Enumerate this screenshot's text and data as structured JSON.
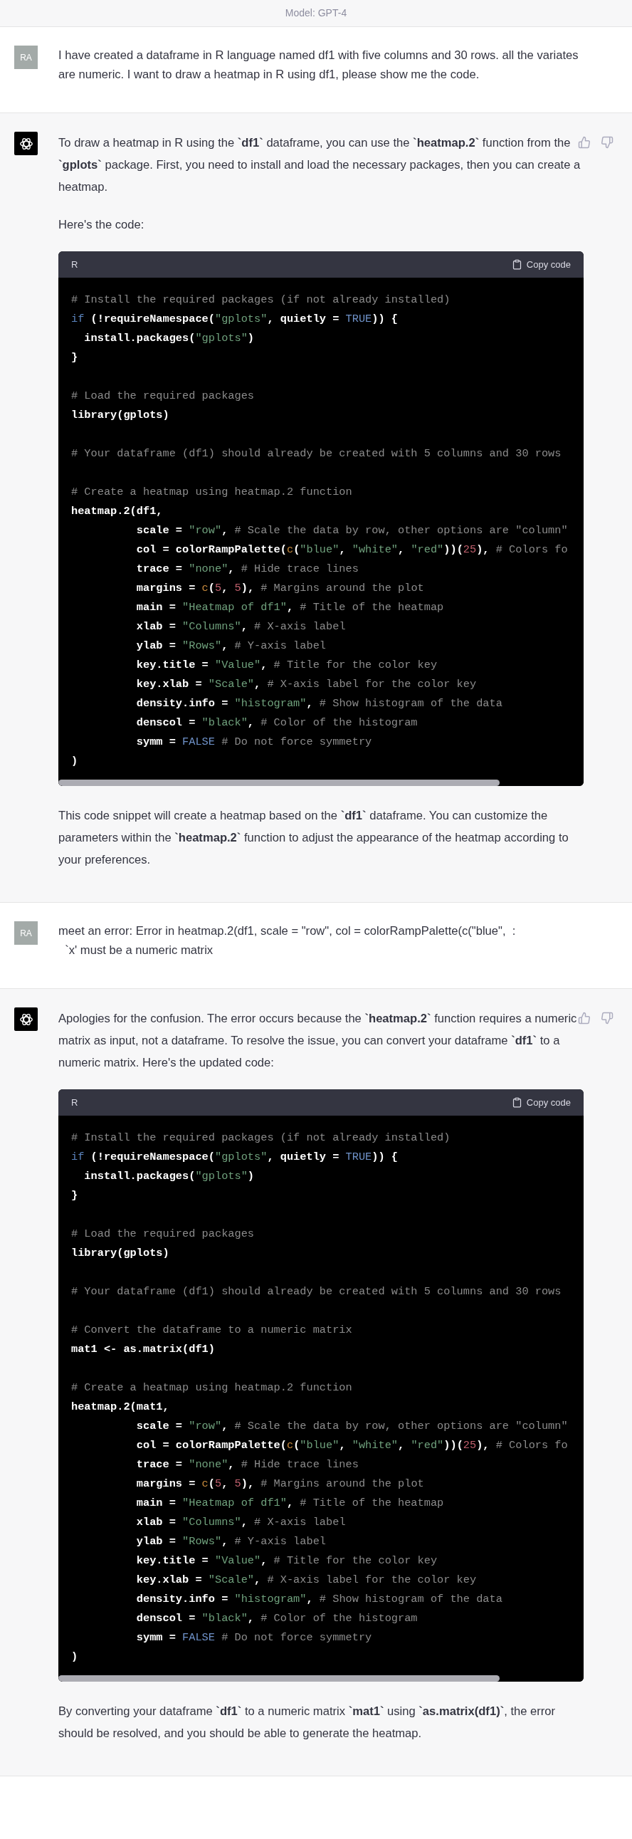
{
  "header": {
    "model_label": "Model: GPT-4"
  },
  "messages": [
    {
      "kind": "user",
      "avatar": "RA",
      "blocks": [
        {
          "kind": "paragraph",
          "text": "I have created a dataframe in R language named df1 with five columns and 30 rows. all the variates are numeric. I want to draw a heatmap in R using df1, please show me the code."
        }
      ]
    },
    {
      "kind": "assistant",
      "blocks": [
        {
          "kind": "paragraph",
          "text": "To draw a heatmap in R using the **`df1`** dataframe, you can use the **`heatmap.2`** function from the **`gplots`** package. First, you need to install and load the necessary packages, then you can create a heatmap."
        },
        {
          "kind": "paragraph",
          "text": "Here's the code:"
        },
        {
          "kind": "code",
          "language": "R",
          "copy_label": "Copy code",
          "lines": [
            {
              "kind": "code",
              "tokens": [
                {
                  "kind": "comment",
                  "text": "# Install the required packages (if not already installed)"
                }
              ]
            },
            {
              "kind": "code",
              "tokens": [
                {
                  "kind": "keyword",
                  "text": "if"
                },
                {
                  "kind": "plain",
                  "text": " (!requireNamespace("
                },
                {
                  "kind": "string",
                  "text": "\"gplots\""
                },
                {
                  "kind": "plain",
                  "text": ", quietly = "
                },
                {
                  "kind": "literal",
                  "text": "TRUE"
                },
                {
                  "kind": "plain",
                  "text": ")) {"
                }
              ]
            },
            {
              "kind": "code",
              "tokens": [
                {
                  "kind": "plain",
                  "text": "  install.packages("
                },
                {
                  "kind": "string",
                  "text": "\"gplots\""
                },
                {
                  "kind": "plain",
                  "text": ")"
                }
              ]
            },
            {
              "kind": "code",
              "tokens": [
                {
                  "kind": "plain",
                  "text": "}"
                }
              ]
            },
            {
              "kind": "blank"
            },
            {
              "kind": "code",
              "tokens": [
                {
                  "kind": "comment",
                  "text": "# Load the required packages"
                }
              ]
            },
            {
              "kind": "code",
              "tokens": [
                {
                  "kind": "plain",
                  "text": "library(gplots)"
                }
              ]
            },
            {
              "kind": "blank"
            },
            {
              "kind": "code",
              "tokens": [
                {
                  "kind": "comment",
                  "text": "# Your dataframe (df1) should already be created with 5 columns and 30 rows"
                }
              ]
            },
            {
              "kind": "blank"
            },
            {
              "kind": "code",
              "tokens": [
                {
                  "kind": "comment",
                  "text": "# Create a heatmap using heatmap.2 function"
                }
              ]
            },
            {
              "kind": "code",
              "tokens": [
                {
                  "kind": "plain",
                  "text": "heatmap.2(df1,"
                }
              ]
            },
            {
              "kind": "code",
              "tokens": [
                {
                  "kind": "plain",
                  "text": "          scale = "
                },
                {
                  "kind": "string",
                  "text": "\"row\""
                },
                {
                  "kind": "plain",
                  "text": ", "
                },
                {
                  "kind": "comment",
                  "text": "# Scale the data by row, other options are \"column\""
                }
              ]
            },
            {
              "kind": "code",
              "tokens": [
                {
                  "kind": "plain",
                  "text": "          col = colorRampPalette("
                },
                {
                  "kind": "builtin",
                  "text": "c"
                },
                {
                  "kind": "plain",
                  "text": "("
                },
                {
                  "kind": "string",
                  "text": "\"blue\""
                },
                {
                  "kind": "plain",
                  "text": ", "
                },
                {
                  "kind": "string",
                  "text": "\"white\""
                },
                {
                  "kind": "plain",
                  "text": ", "
                },
                {
                  "kind": "string",
                  "text": "\"red\""
                },
                {
                  "kind": "plain",
                  "text": "))("
                },
                {
                  "kind": "number",
                  "text": "25"
                },
                {
                  "kind": "plain",
                  "text": "), "
                },
                {
                  "kind": "comment",
                  "text": "# Colors fo"
                }
              ]
            },
            {
              "kind": "code",
              "tokens": [
                {
                  "kind": "plain",
                  "text": "          trace = "
                },
                {
                  "kind": "string",
                  "text": "\"none\""
                },
                {
                  "kind": "plain",
                  "text": ", "
                },
                {
                  "kind": "comment",
                  "text": "# Hide trace lines"
                }
              ]
            },
            {
              "kind": "code",
              "tokens": [
                {
                  "kind": "plain",
                  "text": "          margins = "
                },
                {
                  "kind": "builtin",
                  "text": "c"
                },
                {
                  "kind": "plain",
                  "text": "("
                },
                {
                  "kind": "number",
                  "text": "5"
                },
                {
                  "kind": "plain",
                  "text": ", "
                },
                {
                  "kind": "number",
                  "text": "5"
                },
                {
                  "kind": "plain",
                  "text": "), "
                },
                {
                  "kind": "comment",
                  "text": "# Margins around the plot"
                }
              ]
            },
            {
              "kind": "code",
              "tokens": [
                {
                  "kind": "plain",
                  "text": "          main = "
                },
                {
                  "kind": "string",
                  "text": "\"Heatmap of df1\""
                },
                {
                  "kind": "plain",
                  "text": ", "
                },
                {
                  "kind": "comment",
                  "text": "# Title of the heatmap"
                }
              ]
            },
            {
              "kind": "code",
              "tokens": [
                {
                  "kind": "plain",
                  "text": "          xlab = "
                },
                {
                  "kind": "string",
                  "text": "\"Columns\""
                },
                {
                  "kind": "plain",
                  "text": ", "
                },
                {
                  "kind": "comment",
                  "text": "# X-axis label"
                }
              ]
            },
            {
              "kind": "code",
              "tokens": [
                {
                  "kind": "plain",
                  "text": "          ylab = "
                },
                {
                  "kind": "string",
                  "text": "\"Rows\""
                },
                {
                  "kind": "plain",
                  "text": ", "
                },
                {
                  "kind": "comment",
                  "text": "# Y-axis label"
                }
              ]
            },
            {
              "kind": "code",
              "tokens": [
                {
                  "kind": "plain",
                  "text": "          key.title = "
                },
                {
                  "kind": "string",
                  "text": "\"Value\""
                },
                {
                  "kind": "plain",
                  "text": ", "
                },
                {
                  "kind": "comment",
                  "text": "# Title for the color key"
                }
              ]
            },
            {
              "kind": "code",
              "tokens": [
                {
                  "kind": "plain",
                  "text": "          key.xlab = "
                },
                {
                  "kind": "string",
                  "text": "\"Scale\""
                },
                {
                  "kind": "plain",
                  "text": ", "
                },
                {
                  "kind": "comment",
                  "text": "# X-axis label for the color key"
                }
              ]
            },
            {
              "kind": "code",
              "tokens": [
                {
                  "kind": "plain",
                  "text": "          density.info = "
                },
                {
                  "kind": "string",
                  "text": "\"histogram\""
                },
                {
                  "kind": "plain",
                  "text": ", "
                },
                {
                  "kind": "comment",
                  "text": "# Show histogram of the data"
                }
              ]
            },
            {
              "kind": "code",
              "tokens": [
                {
                  "kind": "plain",
                  "text": "          denscol = "
                },
                {
                  "kind": "string",
                  "text": "\"black\""
                },
                {
                  "kind": "plain",
                  "text": ", "
                },
                {
                  "kind": "comment",
                  "text": "# Color of the histogram"
                }
              ]
            },
            {
              "kind": "code",
              "tokens": [
                {
                  "kind": "plain",
                  "text": "          symm = "
                },
                {
                  "kind": "literal",
                  "text": "FALSE "
                },
                {
                  "kind": "comment",
                  "text": "# Do not force symmetry"
                }
              ]
            },
            {
              "kind": "code",
              "tokens": [
                {
                  "kind": "plain",
                  "text": ")"
                }
              ]
            }
          ]
        },
        {
          "kind": "paragraph",
          "text": "This code snippet will create a heatmap based on the **`df1`** dataframe. You can customize the parameters within the **`heatmap.2`** function to adjust the appearance of the heatmap according to your preferences."
        }
      ]
    },
    {
      "kind": "user",
      "avatar": "RA",
      "blocks": [
        {
          "kind": "paragraph",
          "text": "meet an error: Error in heatmap.2(df1, scale = \"row\", col = colorRampPalette(c(\"blue\",  :\n  `x' must be a numeric matrix"
        }
      ]
    },
    {
      "kind": "assistant",
      "blocks": [
        {
          "kind": "paragraph",
          "text": "Apologies for the confusion. The error occurs because the **`heatmap.2`** function requires a numeric matrix as input, not a dataframe. To resolve the issue, you can convert your dataframe **`df1`** to a numeric matrix. Here's the updated code:"
        },
        {
          "kind": "code",
          "language": "R",
          "copy_label": "Copy code",
          "lines": [
            {
              "kind": "code",
              "tokens": [
                {
                  "kind": "comment",
                  "text": "# Install the required packages (if not already installed)"
                }
              ]
            },
            {
              "kind": "code",
              "tokens": [
                {
                  "kind": "keyword",
                  "text": "if"
                },
                {
                  "kind": "plain",
                  "text": " (!requireNamespace("
                },
                {
                  "kind": "string",
                  "text": "\"gplots\""
                },
                {
                  "kind": "plain",
                  "text": ", quietly = "
                },
                {
                  "kind": "literal",
                  "text": "TRUE"
                },
                {
                  "kind": "plain",
                  "text": ")) {"
                }
              ]
            },
            {
              "kind": "code",
              "tokens": [
                {
                  "kind": "plain",
                  "text": "  install.packages("
                },
                {
                  "kind": "string",
                  "text": "\"gplots\""
                },
                {
                  "kind": "plain",
                  "text": ")"
                }
              ]
            },
            {
              "kind": "code",
              "tokens": [
                {
                  "kind": "plain",
                  "text": "}"
                }
              ]
            },
            {
              "kind": "blank"
            },
            {
              "kind": "code",
              "tokens": [
                {
                  "kind": "comment",
                  "text": "# Load the required packages"
                }
              ]
            },
            {
              "kind": "code",
              "tokens": [
                {
                  "kind": "plain",
                  "text": "library(gplots)"
                }
              ]
            },
            {
              "kind": "blank"
            },
            {
              "kind": "code",
              "tokens": [
                {
                  "kind": "comment",
                  "text": "# Your dataframe (df1) should already be created with 5 columns and 30 rows"
                }
              ]
            },
            {
              "kind": "blank"
            },
            {
              "kind": "code",
              "tokens": [
                {
                  "kind": "comment",
                  "text": "# Convert the dataframe to a numeric matrix"
                }
              ]
            },
            {
              "kind": "code",
              "tokens": [
                {
                  "kind": "plain",
                  "text": "mat1 <- as.matrix(df1)"
                }
              ]
            },
            {
              "kind": "blank"
            },
            {
              "kind": "code",
              "tokens": [
                {
                  "kind": "comment",
                  "text": "# Create a heatmap using heatmap.2 function"
                }
              ]
            },
            {
              "kind": "code",
              "tokens": [
                {
                  "kind": "plain",
                  "text": "heatmap.2(mat1,"
                }
              ]
            },
            {
              "kind": "code",
              "tokens": [
                {
                  "kind": "plain",
                  "text": "          scale = "
                },
                {
                  "kind": "string",
                  "text": "\"row\""
                },
                {
                  "kind": "plain",
                  "text": ", "
                },
                {
                  "kind": "comment",
                  "text": "# Scale the data by row, other options are \"column\""
                }
              ]
            },
            {
              "kind": "code",
              "tokens": [
                {
                  "kind": "plain",
                  "text": "          col = colorRampPalette("
                },
                {
                  "kind": "builtin",
                  "text": "c"
                },
                {
                  "kind": "plain",
                  "text": "("
                },
                {
                  "kind": "string",
                  "text": "\"blue\""
                },
                {
                  "kind": "plain",
                  "text": ", "
                },
                {
                  "kind": "string",
                  "text": "\"white\""
                },
                {
                  "kind": "plain",
                  "text": ", "
                },
                {
                  "kind": "string",
                  "text": "\"red\""
                },
                {
                  "kind": "plain",
                  "text": "))("
                },
                {
                  "kind": "number",
                  "text": "25"
                },
                {
                  "kind": "plain",
                  "text": "), "
                },
                {
                  "kind": "comment",
                  "text": "# Colors fo"
                }
              ]
            },
            {
              "kind": "code",
              "tokens": [
                {
                  "kind": "plain",
                  "text": "          trace = "
                },
                {
                  "kind": "string",
                  "text": "\"none\""
                },
                {
                  "kind": "plain",
                  "text": ", "
                },
                {
                  "kind": "comment",
                  "text": "# Hide trace lines"
                }
              ]
            },
            {
              "kind": "code",
              "tokens": [
                {
                  "kind": "plain",
                  "text": "          margins = "
                },
                {
                  "kind": "builtin",
                  "text": "c"
                },
                {
                  "kind": "plain",
                  "text": "("
                },
                {
                  "kind": "number",
                  "text": "5"
                },
                {
                  "kind": "plain",
                  "text": ", "
                },
                {
                  "kind": "number",
                  "text": "5"
                },
                {
                  "kind": "plain",
                  "text": "), "
                },
                {
                  "kind": "comment",
                  "text": "# Margins around the plot"
                }
              ]
            },
            {
              "kind": "code",
              "tokens": [
                {
                  "kind": "plain",
                  "text": "          main = "
                },
                {
                  "kind": "string",
                  "text": "\"Heatmap of df1\""
                },
                {
                  "kind": "plain",
                  "text": ", "
                },
                {
                  "kind": "comment",
                  "text": "# Title of the heatmap"
                }
              ]
            },
            {
              "kind": "code",
              "tokens": [
                {
                  "kind": "plain",
                  "text": "          xlab = "
                },
                {
                  "kind": "string",
                  "text": "\"Columns\""
                },
                {
                  "kind": "plain",
                  "text": ", "
                },
                {
                  "kind": "comment",
                  "text": "# X-axis label"
                }
              ]
            },
            {
              "kind": "code",
              "tokens": [
                {
                  "kind": "plain",
                  "text": "          ylab = "
                },
                {
                  "kind": "string",
                  "text": "\"Rows\""
                },
                {
                  "kind": "plain",
                  "text": ", "
                },
                {
                  "kind": "comment",
                  "text": "# Y-axis label"
                }
              ]
            },
            {
              "kind": "code",
              "tokens": [
                {
                  "kind": "plain",
                  "text": "          key.title = "
                },
                {
                  "kind": "string",
                  "text": "\"Value\""
                },
                {
                  "kind": "plain",
                  "text": ", "
                },
                {
                  "kind": "comment",
                  "text": "# Title for the color key"
                }
              ]
            },
            {
              "kind": "code",
              "tokens": [
                {
                  "kind": "plain",
                  "text": "          key.xlab = "
                },
                {
                  "kind": "string",
                  "text": "\"Scale\""
                },
                {
                  "kind": "plain",
                  "text": ", "
                },
                {
                  "kind": "comment",
                  "text": "# X-axis label for the color key"
                }
              ]
            },
            {
              "kind": "code",
              "tokens": [
                {
                  "kind": "plain",
                  "text": "          density.info = "
                },
                {
                  "kind": "string",
                  "text": "\"histogram\""
                },
                {
                  "kind": "plain",
                  "text": ", "
                },
                {
                  "kind": "comment",
                  "text": "# Show histogram of the data"
                }
              ]
            },
            {
              "kind": "code",
              "tokens": [
                {
                  "kind": "plain",
                  "text": "          denscol = "
                },
                {
                  "kind": "string",
                  "text": "\"black\""
                },
                {
                  "kind": "plain",
                  "text": ", "
                },
                {
                  "kind": "comment",
                  "text": "# Color of the histogram"
                }
              ]
            },
            {
              "kind": "code",
              "tokens": [
                {
                  "kind": "plain",
                  "text": "          symm = "
                },
                {
                  "kind": "literal",
                  "text": "FALSE "
                },
                {
                  "kind": "comment",
                  "text": "# Do not force symmetry"
                }
              ]
            },
            {
              "kind": "code",
              "tokens": [
                {
                  "kind": "plain",
                  "text": ")"
                }
              ]
            }
          ]
        },
        {
          "kind": "paragraph",
          "text": "By converting your dataframe **`df1`** to a numeric matrix **`mat1`** using **`as.matrix(df1)`**, the error should be resolved, and you should be able to generate the heatmap."
        }
      ]
    }
  ]
}
